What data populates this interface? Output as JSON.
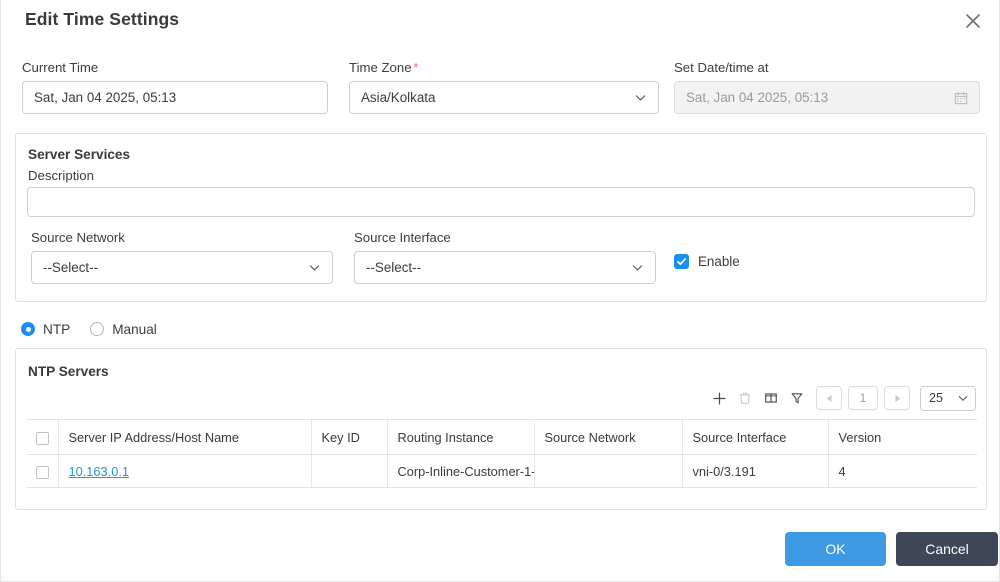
{
  "dialog": {
    "title": "Edit Time Settings",
    "close_icon": "close-icon"
  },
  "fields": {
    "current_time": {
      "label": "Current Time",
      "value": "Sat, Jan 04 2025, 05:13"
    },
    "time_zone": {
      "label": "Time Zone",
      "required_marker": "*",
      "value": "Asia/Kolkata",
      "chevron_icon": "chevron-down-icon"
    },
    "set_datetime": {
      "label": "Set Date/time at",
      "value": "Sat, Jan 04 2025, 05:13",
      "disabled": true,
      "calendar_icon": "calendar-icon"
    }
  },
  "server_services": {
    "title": "Server Services",
    "description_label": "Description",
    "description_value": "",
    "source_network": {
      "label": "Source Network",
      "value": "--Select--",
      "chevron_icon": "chevron-down-icon"
    },
    "source_interface": {
      "label": "Source Interface",
      "value": "--Select--",
      "chevron_icon": "chevron-down-icon"
    },
    "enable": {
      "label": "Enable",
      "checked": true,
      "accent": "#1b8ef3"
    }
  },
  "mode_selector": {
    "options": [
      {
        "label": "NTP",
        "selected": true
      },
      {
        "label": "Manual",
        "selected": false
      }
    ]
  },
  "ntp_servers": {
    "title": "NTP Servers",
    "toolbar": {
      "add_icon": "plus-icon",
      "delete_icon": "trash-icon",
      "columns_icon": "columns-icon",
      "filter_icon": "filter-icon",
      "prev_icon": "caret-left-icon",
      "page_number": "1",
      "next_icon": "caret-right-icon",
      "page_size": "25",
      "page_size_chevron_icon": "chevron-down-icon"
    },
    "table": {
      "select_all_checkbox": false,
      "columns": [
        "Server IP Address/Host Name",
        "Key ID",
        "Routing Instance",
        "Source Network",
        "Source Interface",
        "Version"
      ],
      "rows": [
        {
          "selected": false,
          "server_ip": "10.163.0.1",
          "key_id": "",
          "routing_instance": "Corp-Inline-Customer-1-...",
          "source_network": "",
          "source_interface": "vni-0/3.191",
          "version": "4"
        }
      ]
    }
  },
  "footer": {
    "ok_label": "OK",
    "cancel_label": "Cancel",
    "ok_color": "#3d9ae3",
    "cancel_color": "#3e4757"
  }
}
